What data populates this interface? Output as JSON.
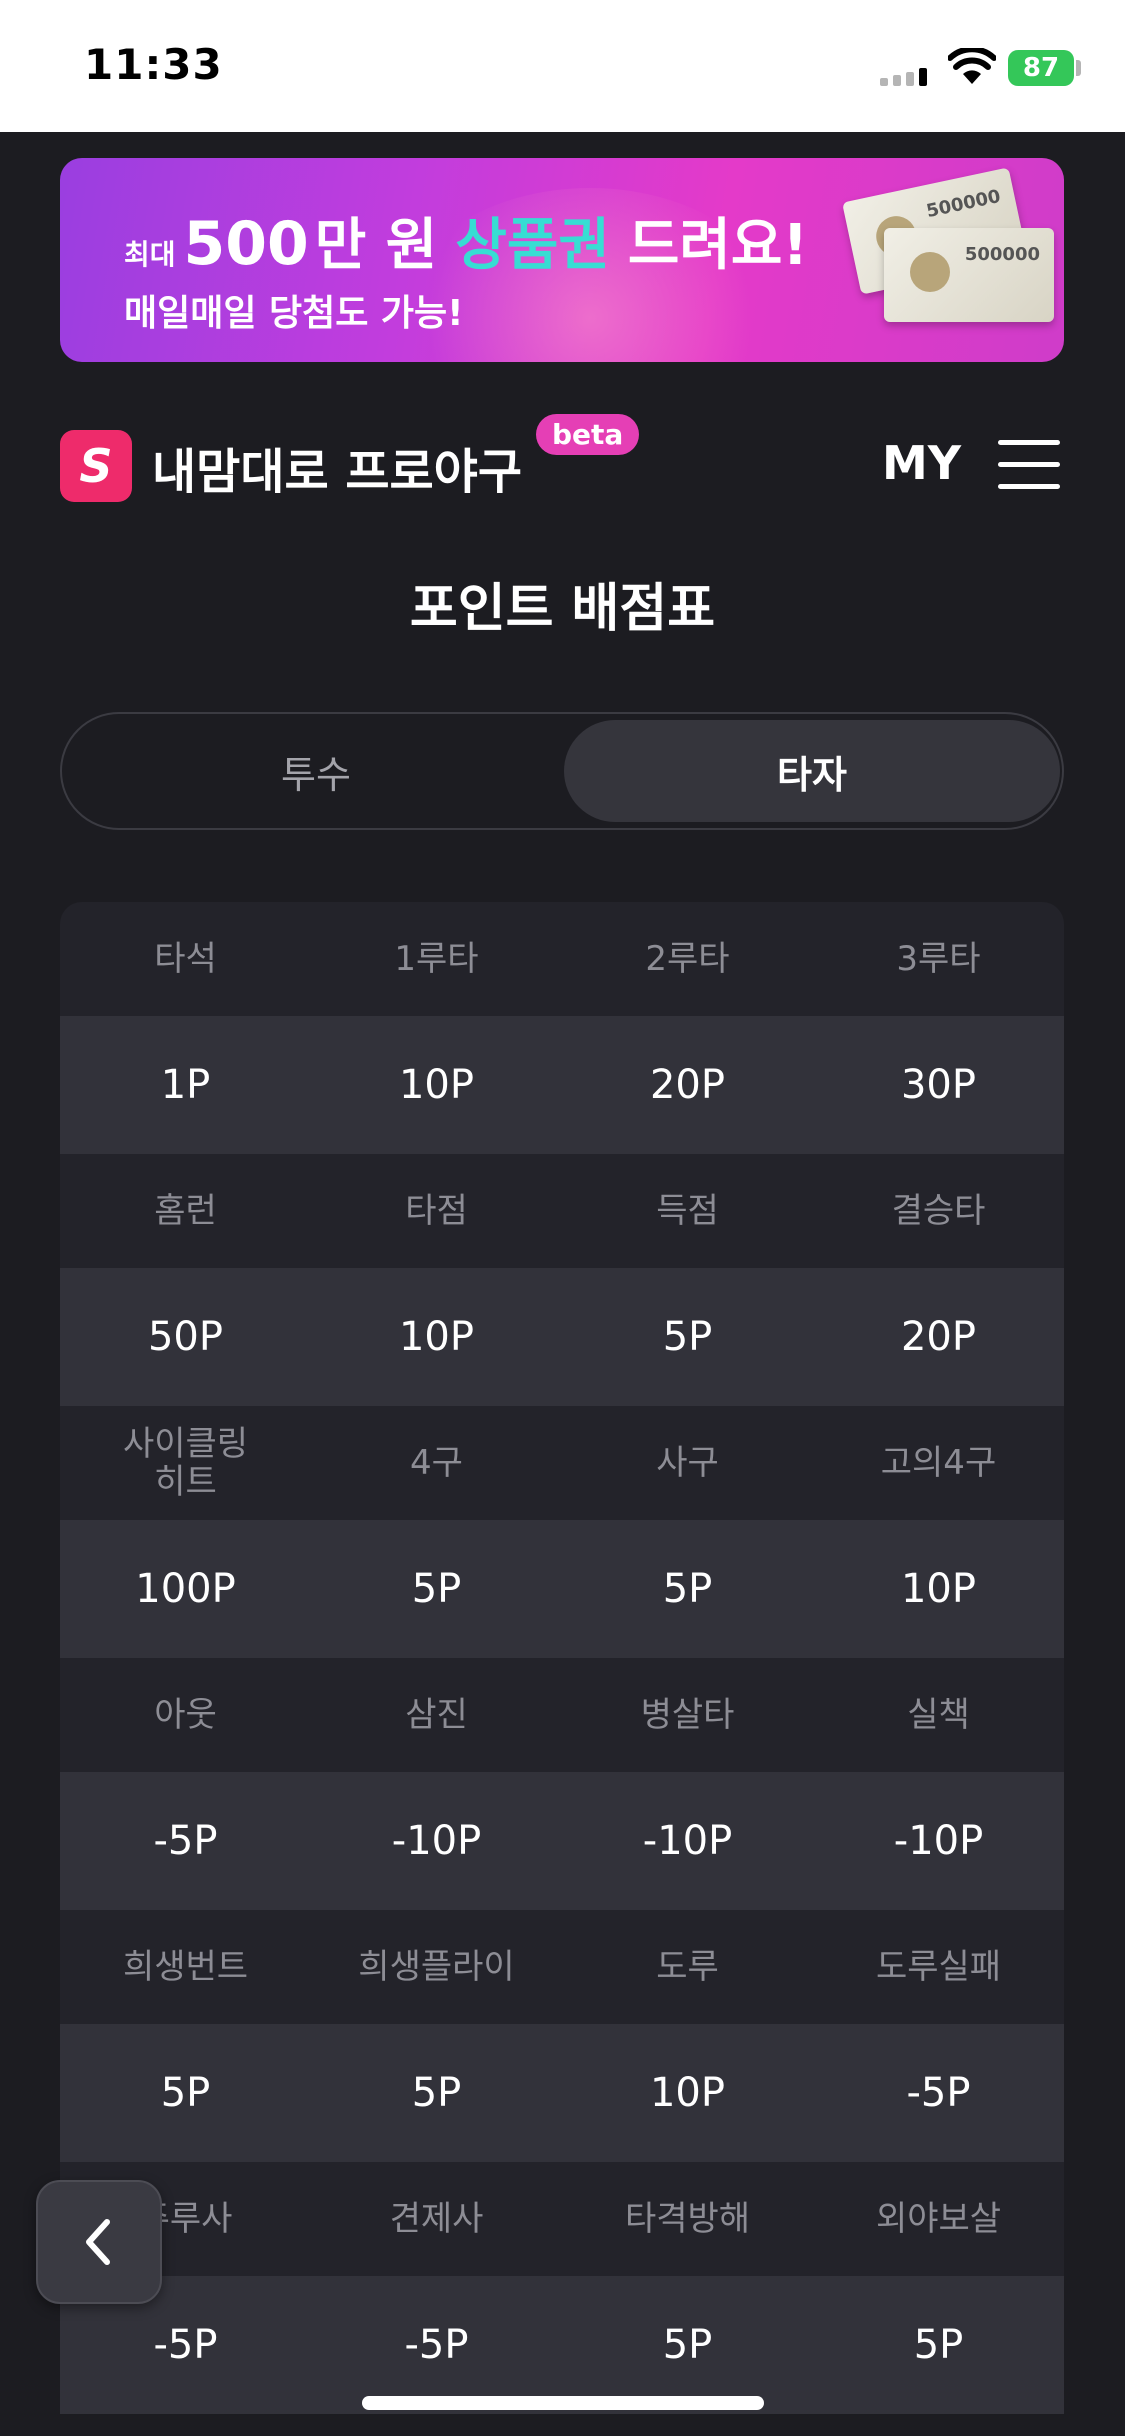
{
  "status_bar": {
    "time": "11:33",
    "battery": "87"
  },
  "banner": {
    "prefix": "최대",
    "amount": "500",
    "unit": "만 원",
    "highlight": "상품권",
    "suffix": "드려요!",
    "sub": "매일매일 당첨도 가능!",
    "voucher_value": "500000"
  },
  "header": {
    "logo_letter": "S",
    "app_title": "내맘대로 프로야구",
    "badge": "beta",
    "my_label": "MY"
  },
  "page_title": "포인트 배점표",
  "toggle": {
    "options": [
      "투수",
      "타자"
    ],
    "selected": "타자"
  },
  "table": {
    "rows": [
      {
        "labels": [
          "타석",
          "1루타",
          "2루타",
          "3루타"
        ],
        "values": [
          "1P",
          "10P",
          "20P",
          "30P"
        ]
      },
      {
        "labels": [
          "홈런",
          "타점",
          "득점",
          "결승타"
        ],
        "values": [
          "50P",
          "10P",
          "5P",
          "20P"
        ]
      },
      {
        "labels": [
          "사이클링\n히트",
          "4구",
          "사구",
          "고의4구"
        ],
        "values": [
          "100P",
          "5P",
          "5P",
          "10P"
        ]
      },
      {
        "labels": [
          "아웃",
          "삼진",
          "병살타",
          "실책"
        ],
        "values": [
          "-5P",
          "-10P",
          "-10P",
          "-10P"
        ]
      },
      {
        "labels": [
          "희생번트",
          "희생플라이",
          "도루",
          "도루실패"
        ],
        "values": [
          "5P",
          "5P",
          "10P",
          "-5P"
        ]
      },
      {
        "labels": [
          "주루사",
          "견제사",
          "타격방해",
          "외야보살"
        ],
        "values": [
          "-5P",
          "-5P",
          "5P",
          "5P"
        ]
      }
    ]
  },
  "colors": {
    "background": "#1c1c21",
    "brand": "#ee2b6b",
    "beta": "#e53fb5",
    "accent_teal": "#37ddd3",
    "battery": "#34c759"
  }
}
